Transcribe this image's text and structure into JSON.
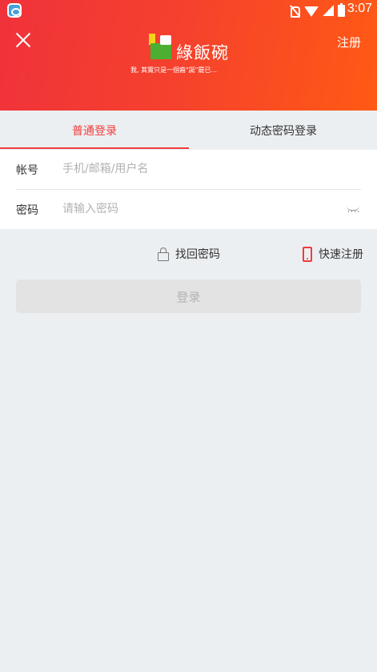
{
  "status_bar": {
    "time": "3:07"
  },
  "header": {
    "register_label": "注册",
    "logo_text": "綠飯碗",
    "slogan": "我, 其實只是一個裔\"誕\"罷已..."
  },
  "tabs": [
    {
      "label": "普通登录",
      "active": true
    },
    {
      "label": "动态密码登录",
      "active": false
    }
  ],
  "form": {
    "account_label": "帐号",
    "account_placeholder": "手机/邮箱/用户名",
    "password_label": "密码",
    "password_placeholder": "请输入密码"
  },
  "links": {
    "find_password": "找回密码",
    "quick_register": "快速注册"
  },
  "login_button": "登录",
  "colors": {
    "accent": "#f03c3c",
    "header_start": "#f0323a",
    "header_end": "#ff5a14",
    "background": "#eceff1",
    "button_disabled": "#e3e3e3"
  }
}
